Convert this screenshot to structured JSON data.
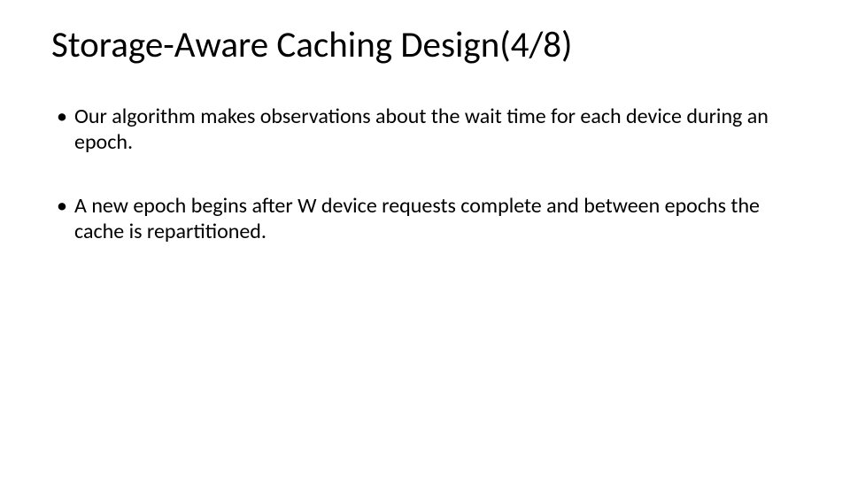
{
  "slide": {
    "title": "Storage-Aware Caching Design(4/8)",
    "bullets": [
      "Our algorithm makes observations about the wait time for each device during an epoch.",
      " A new epoch begins after W device requests complete and between epochs the cache is repartitioned."
    ]
  }
}
